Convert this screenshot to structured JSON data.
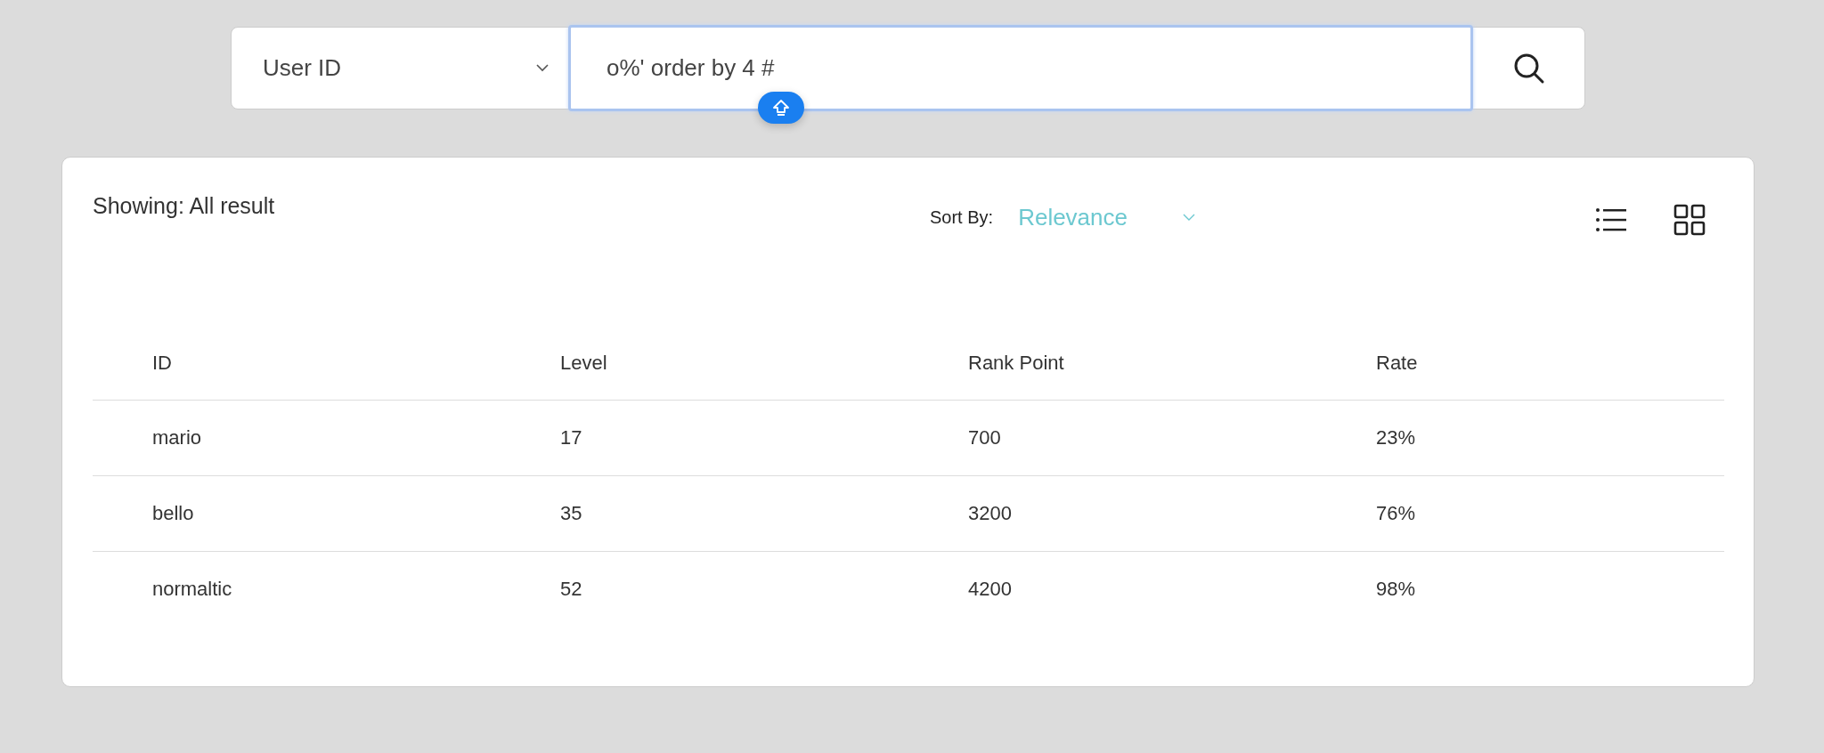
{
  "search": {
    "field_select": "User ID",
    "query": "o%' order by 4 #"
  },
  "results": {
    "showing": "Showing: All result",
    "sort_label": "Sort By:",
    "sort_value": "Relevance",
    "table": {
      "columns": [
        "ID",
        "Level",
        "Rank Point",
        "Rate"
      ],
      "rows": [
        [
          "mario",
          "17",
          "700",
          "23%"
        ],
        [
          "bello",
          "35",
          "3200",
          "76%"
        ],
        [
          "normaltic",
          "52",
          "4200",
          "98%"
        ]
      ]
    }
  }
}
